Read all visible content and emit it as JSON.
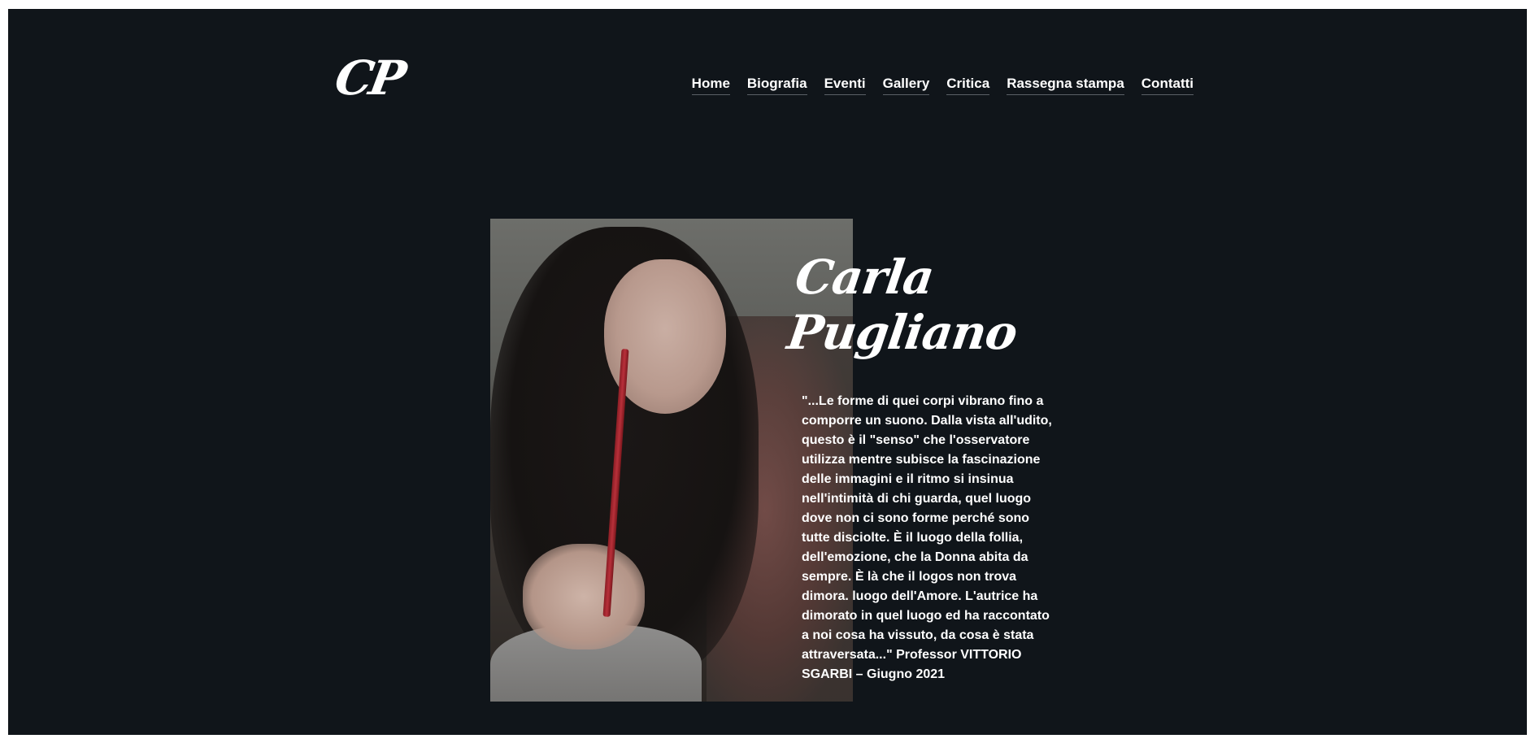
{
  "logo": {
    "text": "CP"
  },
  "nav": {
    "items": [
      {
        "label": "Home"
      },
      {
        "label": "Biografia"
      },
      {
        "label": "Eventi"
      },
      {
        "label": "Gallery"
      },
      {
        "label": "Critica"
      },
      {
        "label": "Rassegna stampa"
      },
      {
        "label": "Contatti"
      }
    ]
  },
  "hero": {
    "name_line1": "Carla",
    "name_line2": "Pugliano",
    "quote": "\"...Le forme di quei corpi vibrano fino a comporre un suono. Dalla vista all'udito, questo è il \"senso\" che l'osservatore utilizza mentre subisce la fascinazione delle immagini e il ritmo si insinua nell'intimità di chi guarda, quel luogo dove non ci sono forme perché sono tutte disciolte. È il luogo della follia, dell'emozione, che la Donna abita da sempre. È là che il logos non trova dimora. luogo dell'Amore. L'autrice ha dimorato in quel luogo ed ha raccontato a noi cosa ha vissuto, da cosa è stata attraversata...\" Professor VITTORIO SGARBI – Giugno 2021"
  },
  "colors": {
    "background": "#10151a",
    "text": "#ffffff",
    "nav_underline": "#5a6066"
  }
}
